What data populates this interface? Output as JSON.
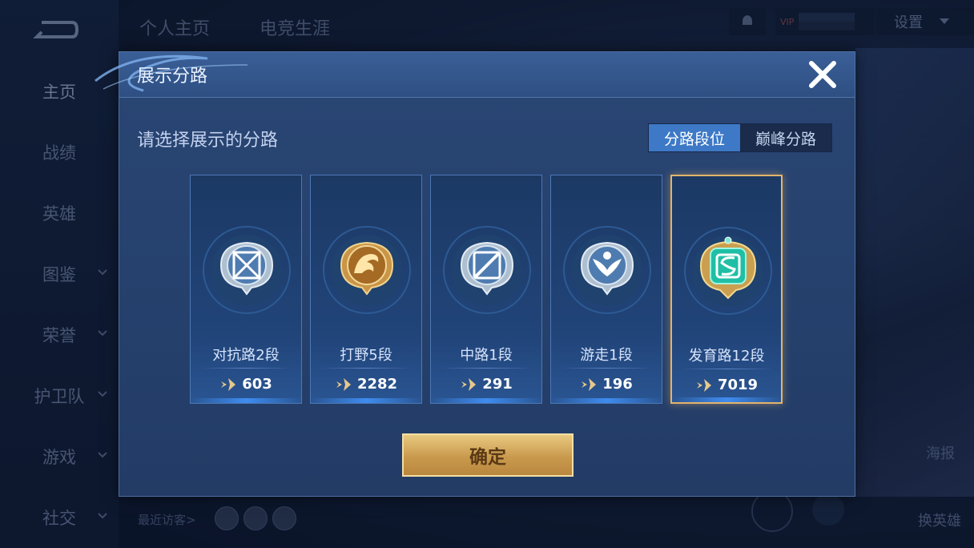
{
  "background": {
    "nav_items": [
      {
        "label": "主页"
      },
      {
        "label": "战绩"
      },
      {
        "label": "英雄"
      },
      {
        "label": "图鉴"
      },
      {
        "label": "荣誉"
      },
      {
        "label": "护卫队"
      },
      {
        "label": "游戏"
      },
      {
        "label": "社交"
      }
    ],
    "top_tabs": [
      "个人主页",
      "电竞生涯"
    ],
    "vip_label": "VIP",
    "settings_label": "设置",
    "side_labels": [
      "海报",
      "换英雄"
    ],
    "recent_visitors_label": "最近访客>"
  },
  "modal": {
    "title": "展示分路",
    "subtitle": "请选择展示的分路",
    "toggle": {
      "option1": "分路段位",
      "option2": "巅峰分路",
      "selected": "分路段位"
    },
    "confirm_label": "确定",
    "lanes": [
      {
        "name": "对抗路2段",
        "score": "603",
        "emblem": "clash-lane-emblem",
        "selected": false
      },
      {
        "name": "打野5段",
        "score": "2282",
        "emblem": "jungle-emblem",
        "selected": false
      },
      {
        "name": "中路1段",
        "score": "291",
        "emblem": "mid-lane-emblem",
        "selected": false
      },
      {
        "name": "游走1段",
        "score": "196",
        "emblem": "roam-emblem",
        "selected": false
      },
      {
        "name": "发育路12段",
        "score": "7019",
        "emblem": "farm-lane-emblem",
        "selected": true
      }
    ]
  },
  "colors": {
    "accent_blue": "#3d79c6",
    "gold": "#e4b46a",
    "modal_bg": "#223c66"
  }
}
